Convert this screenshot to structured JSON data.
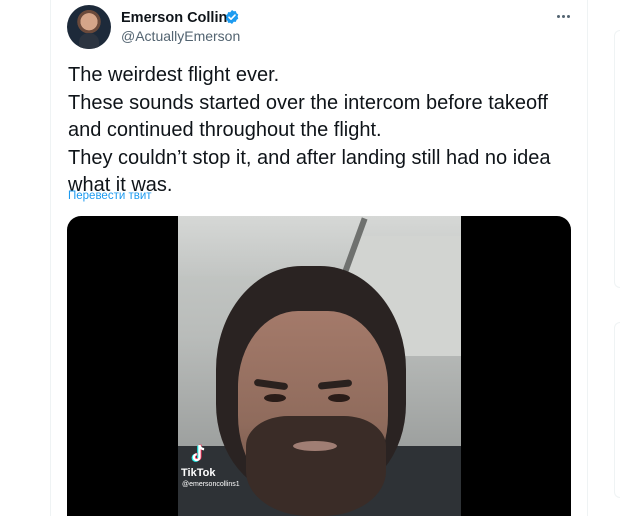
{
  "author": {
    "display_name": "Emerson Collins",
    "handle": "@ActuallyEmerson",
    "verified": true
  },
  "tweet": {
    "text": "The weirdest flight ever.\nThese sounds started over the intercom before takeoff\nand continued throughout the flight.\nThey couldn’t stop it, and after landing still had no idea\nwhat it was.",
    "translate_label": "Перевести твит"
  },
  "media": {
    "watermark_brand": "TikTok",
    "watermark_handle": "@emersoncollins1"
  },
  "colors": {
    "accent": "#1d9bf0",
    "secondary_text": "#536471",
    "primary_text": "#0f1419"
  },
  "icons": {
    "verified": "verified-badge-icon",
    "more": "more-options-icon",
    "tiktok": "tiktok-logo-icon"
  }
}
